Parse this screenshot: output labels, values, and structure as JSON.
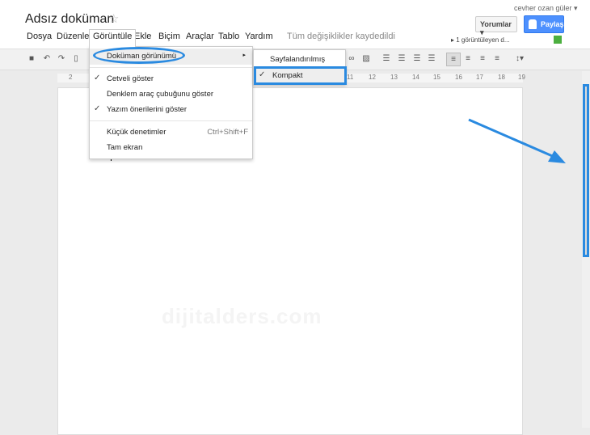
{
  "header": {
    "title": "Adsız doküman",
    "user": "cevher ozan güler ▾",
    "comments_label": "Yorumlar ▾",
    "share_label": "Paylaş",
    "viewers": "▸ 1 görüntüleyen d...",
    "status_color": "#4caf3f"
  },
  "menubar": {
    "items": [
      "Dosya",
      "Düzenle",
      "Görüntüle",
      "Ekle",
      "Biçim",
      "Araçlar",
      "Tablo",
      "Yardım"
    ],
    "saved_status": "Tüm değişiklikler kaydedildi"
  },
  "ruler": {
    "numbers": [
      "2",
      "11",
      "12",
      "13",
      "14",
      "15",
      "16",
      "17",
      "18",
      "19"
    ]
  },
  "view_menu": {
    "items": [
      {
        "label": "Doküman görünümü",
        "arrow": "▸",
        "highlighted": true
      },
      {
        "label": "Cetveli göster",
        "checked": true,
        "check": "✓"
      },
      {
        "label": "Denklem araç çubuğunu göster",
        "checked": false
      },
      {
        "label": "Yazım önerilerini göster",
        "checked": true,
        "check": "✓"
      },
      {
        "label": "Küçük denetimler",
        "shortcut": "Ctrl+Shift+F"
      },
      {
        "label": "Tam ekran"
      }
    ]
  },
  "document_view_submenu": {
    "items": [
      {
        "label": "Sayfalandırılmış",
        "checked": false
      },
      {
        "label": "Kompakt",
        "checked": true,
        "check": "✓"
      }
    ]
  },
  "watermark": "dijitalders.com",
  "annotation_color": "#2a8ae0"
}
